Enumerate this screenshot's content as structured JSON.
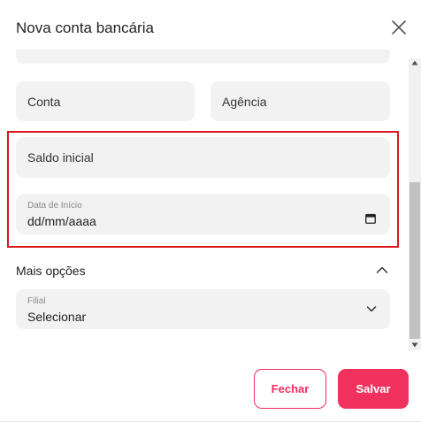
{
  "modal": {
    "title": "Nova conta bancária",
    "close_icon": "close-icon"
  },
  "fields": {
    "conta": {
      "placeholder": "Conta"
    },
    "agencia": {
      "placeholder": "Agência"
    },
    "saldo_inicial": {
      "placeholder": "Saldo inicial"
    },
    "data_inicio": {
      "label": "Data de Início",
      "value": "dd/mm/aaaa",
      "icon": "calendar-icon"
    },
    "filial": {
      "label": "Filial",
      "value": "Selecionar",
      "icon": "chevron-down-icon"
    }
  },
  "more_options": {
    "title": "Mais opções",
    "icon": "chevron-up-icon"
  },
  "actions": {
    "close_label": "Fechar",
    "save_label": "Salvar"
  },
  "colors": {
    "accent": "#f0315d",
    "highlight": "#d9181f",
    "field_bg": "#f2f2f2"
  }
}
